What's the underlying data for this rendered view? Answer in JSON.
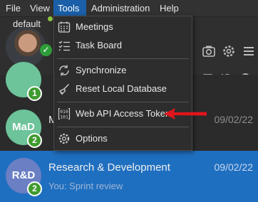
{
  "menubar": {
    "items": [
      {
        "label": "File"
      },
      {
        "label": "View"
      },
      {
        "label": "Tools"
      },
      {
        "label": "Administration"
      },
      {
        "label": "Help"
      }
    ]
  },
  "status": {
    "label": "default"
  },
  "tools_menu": {
    "items": [
      {
        "label": "Meetings",
        "icon": "calendar-icon"
      },
      {
        "label": "Task Board",
        "icon": "checklist-icon"
      },
      {
        "label": "Synchronize",
        "icon": "sync-icon"
      },
      {
        "label": "Reset Local Database",
        "icon": "broom-icon"
      },
      {
        "label": "Web API Access Token",
        "icon": "binary-braces-icon"
      },
      {
        "label": "Options",
        "icon": "gear-icon"
      }
    ]
  },
  "chats": [
    {
      "initials": "MaD",
      "title": "M",
      "subtitle": "",
      "date": "09/02/22",
      "badge": "2",
      "color": "#6dc39a"
    },
    {
      "initials": "R&D",
      "title": "Research & Development",
      "subtitle": "You: Sprint review",
      "date": "09/02/22",
      "badge": "2",
      "color": "#6b7fc4"
    }
  ],
  "partial_chat_badge": "1",
  "colors": {
    "accent": "#1a5fa8",
    "selected_row": "#1f6fc0",
    "arrow": "#e0161c",
    "online": "#2e9e3a"
  }
}
